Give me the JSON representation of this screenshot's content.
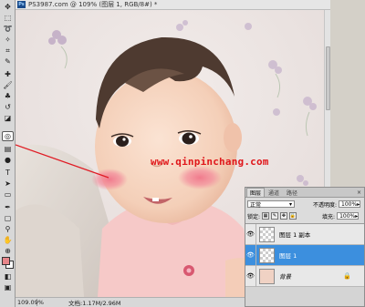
{
  "document": {
    "title": "PS3987.com @ 109% (图层 1, RGB/8#) *",
    "zoom": "109.09%",
    "doc_info": "文档:1.17M/2.96M",
    "watermark": "www.qinpinchang.com"
  },
  "toolbox": {
    "tools": [
      "move-tool-icon",
      "marquee-tool-icon",
      "lasso-tool-icon",
      "magic-wand-tool-icon",
      "crop-tool-icon",
      "slice-tool-icon",
      "healing-brush-tool-icon",
      "brush-tool-icon",
      "clone-stamp-tool-icon",
      "history-brush-tool-icon",
      "eraser-tool-icon",
      "gradient-tool-icon",
      "blur-tool-icon",
      "dodge-tool-icon",
      "pen-tool-icon",
      "type-tool-icon",
      "path-selection-tool-icon",
      "shape-tool-icon",
      "notes-tool-icon",
      "eyedropper-tool-icon",
      "hand-tool-icon",
      "zoom-tool-icon"
    ],
    "foreground_color": "#e8868a",
    "background_color": "#ffffff"
  },
  "layers_panel": {
    "tabs": [
      "图层",
      "通道",
      "路径"
    ],
    "active_tab": "图层",
    "blend_mode": "正常",
    "opacity_label": "不透明度:",
    "opacity_value": "100%",
    "lock_label": "锁定:",
    "fill_label": "填充:",
    "fill_value": "100%",
    "layers": [
      {
        "name": "图层 1 副本",
        "visible": true,
        "selected": false
      },
      {
        "name": "图层 1",
        "visible": true,
        "selected": true
      },
      {
        "name": "背景",
        "visible": true,
        "selected": false,
        "locked": true
      }
    ]
  },
  "colors": {
    "selection": "#3c8fde",
    "watermark": "#e0161a",
    "blush": "#f0768a"
  }
}
